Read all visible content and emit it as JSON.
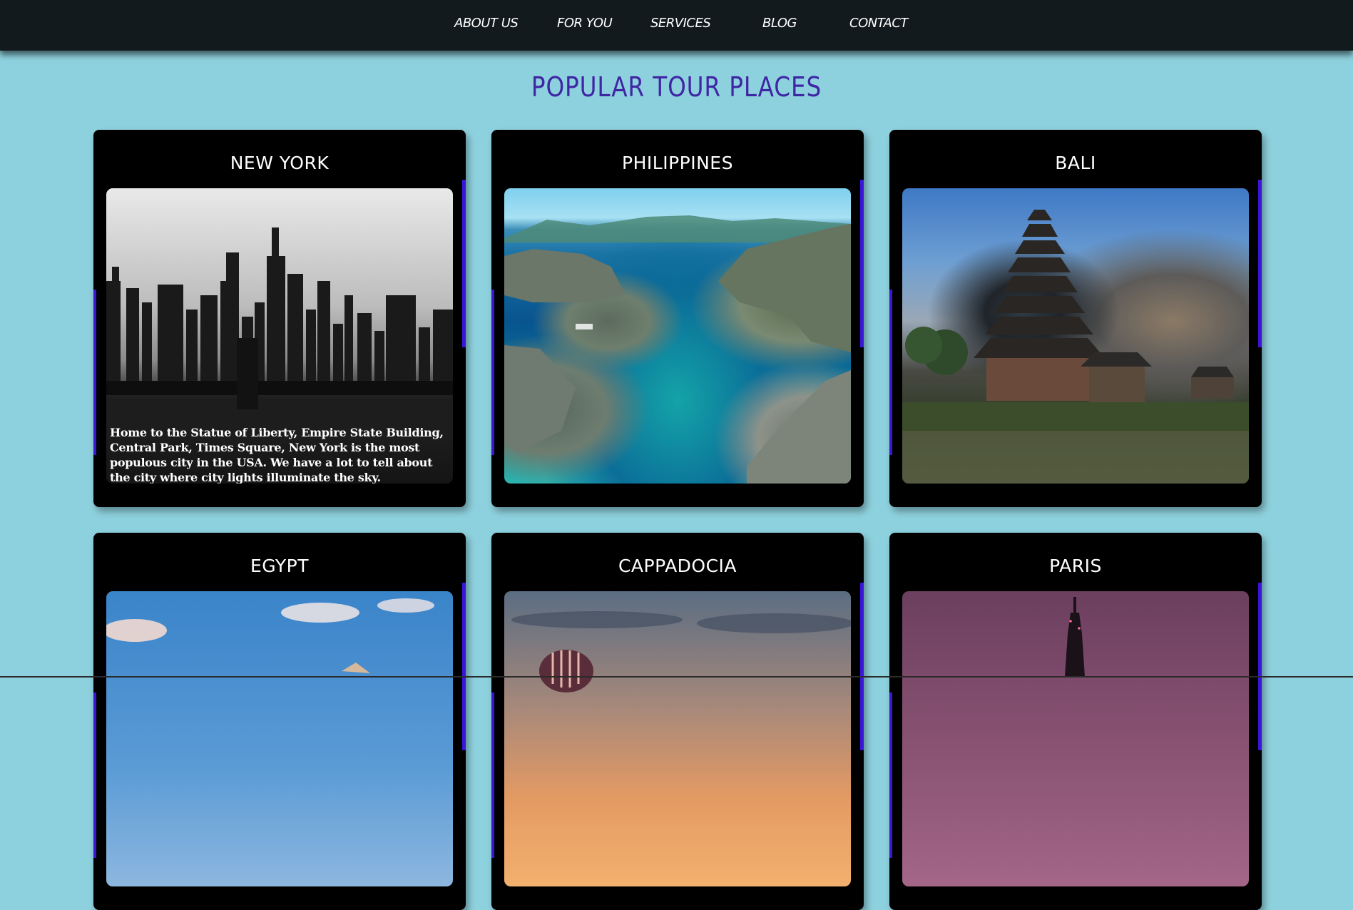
{
  "nav": {
    "items": [
      {
        "label": "ABOUT US"
      },
      {
        "label": "FOR YOU"
      },
      {
        "label": "SERVICES"
      },
      {
        "label": "BLOG"
      },
      {
        "label": "CONTACT"
      }
    ]
  },
  "section": {
    "title": "POPULAR TOUR PLACES"
  },
  "cards": [
    {
      "title": "NEW YORK",
      "caption": "Home to the Statue of Liberty, Empire State Building, Central Park, Times Square, New York is the most populous city in the USA. We have a lot to tell about the city where city lights illuminate the sky."
    },
    {
      "title": "PHILIPPINES"
    },
    {
      "title": "BALI"
    },
    {
      "title": "EGYPT"
    },
    {
      "title": "CAPPADOCIA"
    },
    {
      "title": "PARIS"
    }
  ],
  "colors": {
    "page_background": "#8ed1de",
    "nav_background": "#121a1d",
    "title_color": "#3f27a4",
    "card_background": "#000000",
    "card_accent": "#3a16d6"
  }
}
